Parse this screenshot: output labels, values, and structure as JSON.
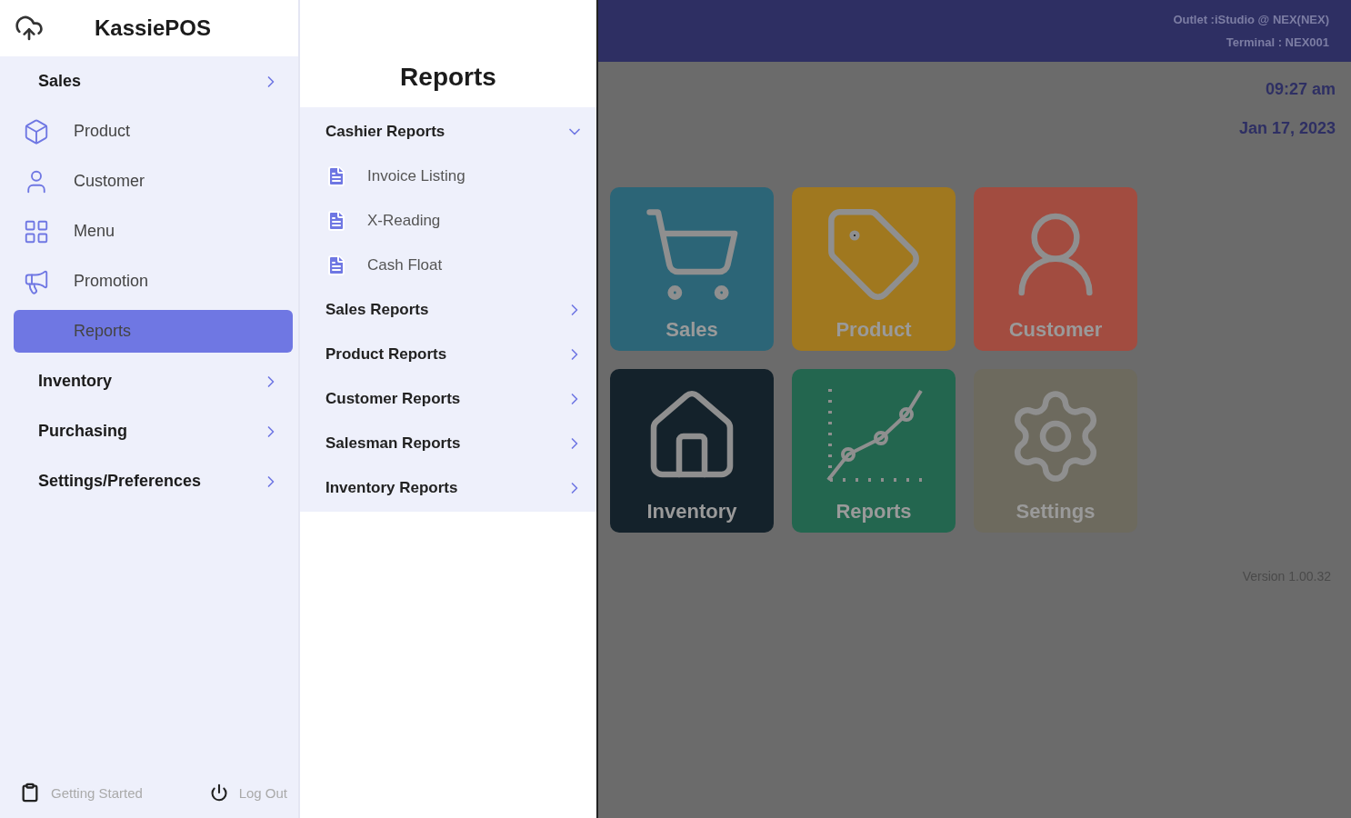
{
  "app": {
    "title": "KassiePOS"
  },
  "sidebar": {
    "items": [
      {
        "kind": "group",
        "label": "Sales",
        "selected": false
      },
      {
        "kind": "link",
        "label": "Product",
        "selected": false
      },
      {
        "kind": "link",
        "label": "Customer",
        "selected": false
      },
      {
        "kind": "link",
        "label": "Menu",
        "selected": false
      },
      {
        "kind": "link",
        "label": "Promotion",
        "selected": false
      },
      {
        "kind": "link",
        "label": "Reports",
        "selected": true
      },
      {
        "kind": "group",
        "label": "Inventory",
        "selected": false
      },
      {
        "kind": "group",
        "label": "Purchasing",
        "selected": false
      },
      {
        "kind": "group",
        "label": "Settings/Preferences",
        "selected": false
      }
    ],
    "footer": [
      "Getting Started",
      "Log Out"
    ]
  },
  "reports_panel": {
    "title": "Reports",
    "sections": [
      {
        "label": "Cashier Reports",
        "expanded": true,
        "children": [
          {
            "label": "Invoice Listing"
          },
          {
            "label": "X-Reading"
          },
          {
            "label": "Cash Float"
          }
        ]
      },
      {
        "label": "Sales Reports",
        "expanded": false
      },
      {
        "label": "Product Reports",
        "expanded": false
      },
      {
        "label": "Customer Reports",
        "expanded": false
      },
      {
        "label": "Salesman Reports",
        "expanded": false
      },
      {
        "label": "Inventory Reports",
        "expanded": false
      }
    ]
  },
  "header": {
    "outlet": "Outlet :iStudio @ NEX(NEX)",
    "terminal": "Terminal : NEX001"
  },
  "time": "09:27 am",
  "date": "Jan 17, 2023",
  "tiles": [
    {
      "label": "Sales",
      "color": "#2c6577"
    },
    {
      "label": "Product",
      "color": "#a0781f"
    },
    {
      "label": "Customer",
      "color": "#a24c40"
    },
    {
      "label": "Inventory",
      "color": "#14222b"
    },
    {
      "label": "Reports",
      "color": "#23664f"
    },
    {
      "label": "Settings",
      "color": "#6d6a5e"
    }
  ],
  "version": "Version 1.00.32"
}
